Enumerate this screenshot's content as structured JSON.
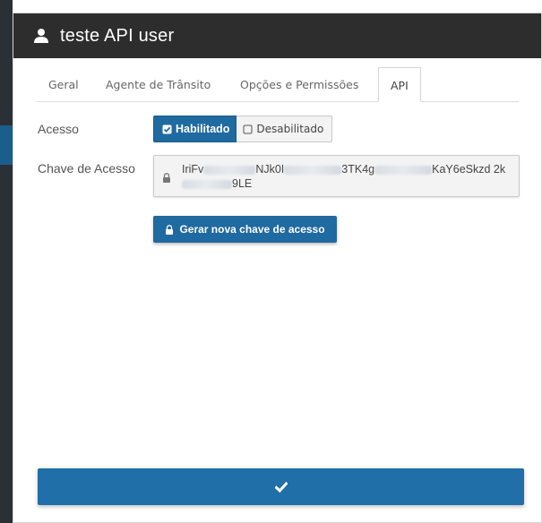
{
  "modal": {
    "title": "teste API user",
    "title_icon": "user-icon"
  },
  "tabs": [
    {
      "label": "Geral",
      "active": false
    },
    {
      "label": "Agente de Trânsito",
      "active": false
    },
    {
      "label": "Opções e Permissões",
      "active": false
    },
    {
      "label": "API",
      "active": true
    }
  ],
  "access": {
    "label": "Acesso",
    "options": [
      {
        "label": "Habilitado",
        "selected": true,
        "icon": "checkbox-checked-icon"
      },
      {
        "label": "Desabilitado",
        "selected": false,
        "icon": "checkbox-empty-icon"
      }
    ]
  },
  "key": {
    "label": "Chave de Acesso",
    "icon": "lock-icon",
    "parts": [
      "IriFv",
      "NJk0I",
      "3TK4g",
      "KaY6eSkzd",
      "2k",
      "9LE"
    ]
  },
  "generate_button": {
    "label": "Gerar nova chave de acesso",
    "icon": "lock-icon"
  },
  "confirm_button": {
    "icon": "check-icon"
  },
  "colors": {
    "header_bg": "#2d2d2d",
    "primary": "#1f6aa0",
    "confirm": "#216fa8"
  }
}
